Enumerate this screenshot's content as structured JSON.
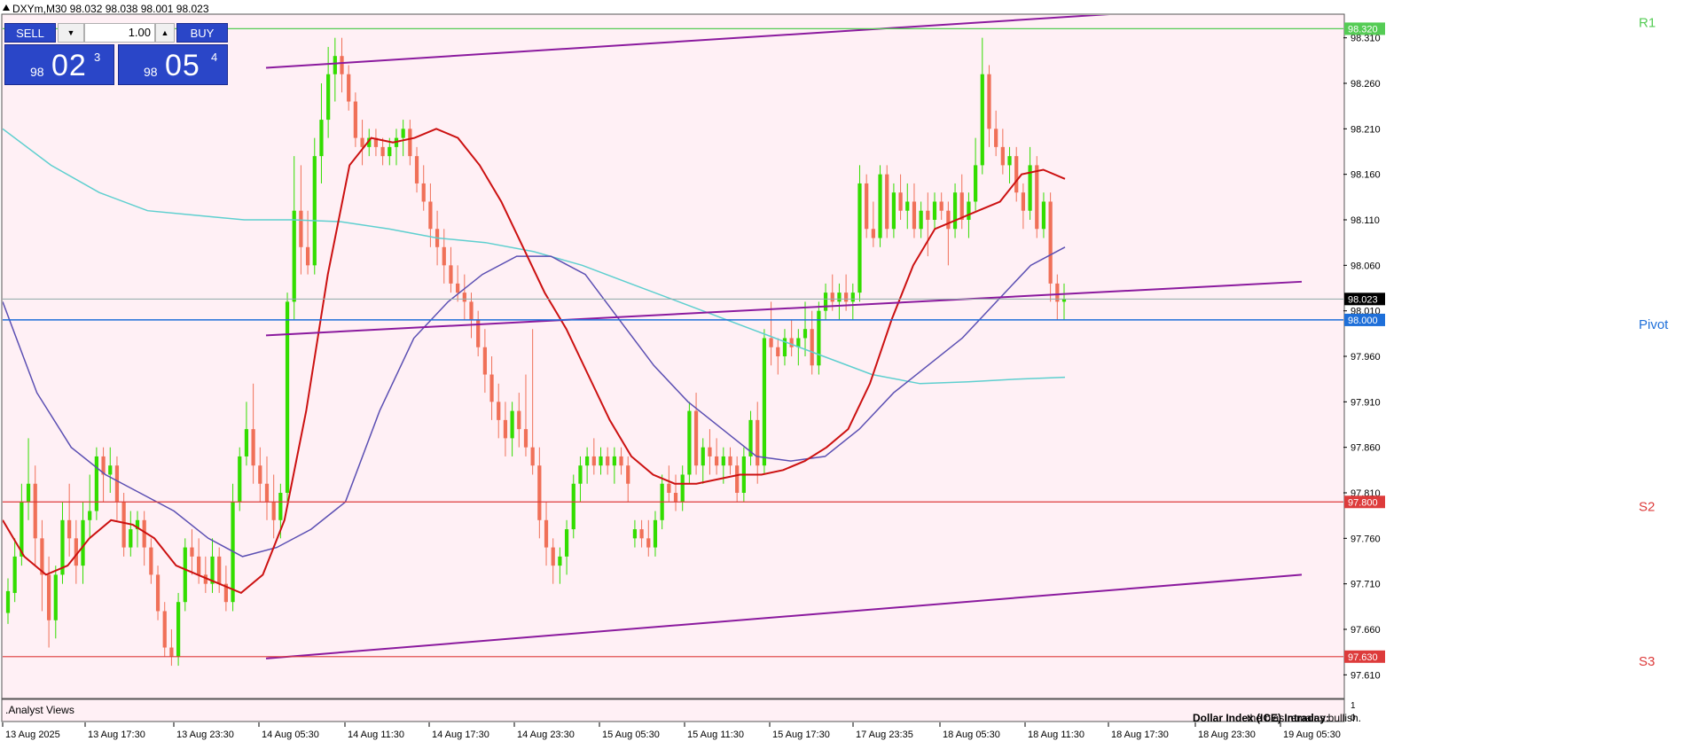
{
  "header": {
    "symbol_info": "DXYm,M30  98.032 98.038 98.001 98.023"
  },
  "trade_panel": {
    "sell_label": "SELL",
    "buy_label": "BUY",
    "lot": "1.00",
    "sell_quote": {
      "small": "98",
      "big": "02",
      "sup": "3"
    },
    "buy_quote": {
      "small": "98",
      "big": "05",
      "sup": "4"
    }
  },
  "indicator_panel": {
    "label": ".Analyst Views",
    "scale_top": "1",
    "scale_bottom": "0",
    "comment_title": "Dollar Index (ICE) Intraday:",
    "comment_text": "the bias remains bullish."
  },
  "colors": {
    "background": "#fff0f5",
    "bull": "#33dd00",
    "bear": "#f07058",
    "ma_red": "#cc1111",
    "ma_blue": "#5b4fb3",
    "ma_cyan": "#5ecfcf",
    "channel": "#8b1a9e",
    "r1": "#55cc55",
    "pivot": "#1e6fd9",
    "support": "#dd3b3b",
    "current": "#2b2b2b"
  },
  "chart_data": {
    "type": "candlestick",
    "timeframe": "M30",
    "ylim": [
      97.585,
      98.335
    ],
    "y_ticks": [
      "98.310",
      "98.260",
      "98.210",
      "98.160",
      "98.110",
      "98.060",
      "98.010",
      "97.960",
      "97.910",
      "97.860",
      "97.810",
      "97.760",
      "97.710",
      "97.660",
      "97.610"
    ],
    "x_labels": [
      "13 Aug 2025",
      "13 Aug 17:30",
      "13 Aug 23:30",
      "14 Aug 05:30",
      "14 Aug 11:30",
      "14 Aug 17:30",
      "14 Aug 23:30",
      "15 Aug 05:30",
      "15 Aug 11:30",
      "15 Aug 17:30",
      "17 Aug 23:35",
      "18 Aug 05:30",
      "18 Aug 11:30",
      "18 Aug 17:30",
      "18 Aug 23:30",
      "19 Aug 05:30"
    ],
    "levels": [
      {
        "name": "R1",
        "value": 98.32,
        "price_label": "98.320",
        "color": "#55cc55"
      },
      {
        "name": "Pivot",
        "value": 98.0,
        "price_label": "98.000",
        "color": "#1e6fd9"
      },
      {
        "name": "S2",
        "value": 97.8,
        "price_label": "97.800",
        "color": "#dd3b3b"
      },
      {
        "name": "S3",
        "value": 97.63,
        "price_label": "97.630",
        "color": "#dd3b3b"
      }
    ],
    "current_price": {
      "value": 98.023,
      "label": "98.023"
    },
    "candles": [
      [
        97.678,
        97.716,
        97.666,
        97.702
      ],
      [
        97.7,
        97.76,
        97.69,
        97.74
      ],
      [
        97.74,
        97.82,
        97.73,
        97.8
      ],
      [
        97.8,
        97.87,
        97.78,
        97.82
      ],
      [
        97.82,
        97.84,
        97.73,
        97.76
      ],
      [
        97.76,
        97.78,
        97.68,
        97.72
      ],
      [
        97.72,
        97.74,
        97.64,
        97.67
      ],
      [
        97.67,
        97.73,
        97.65,
        97.72
      ],
      [
        97.72,
        97.8,
        97.71,
        97.78
      ],
      [
        97.78,
        97.82,
        97.74,
        97.76
      ],
      [
        97.76,
        97.78,
        97.71,
        97.73
      ],
      [
        97.73,
        97.8,
        97.71,
        97.78
      ],
      [
        97.78,
        97.83,
        97.76,
        97.79
      ],
      [
        97.79,
        97.86,
        97.78,
        97.85
      ],
      [
        97.85,
        97.86,
        97.8,
        97.83
      ],
      [
        97.83,
        97.86,
        97.81,
        97.84
      ],
      [
        97.84,
        97.85,
        97.78,
        97.8
      ],
      [
        97.8,
        97.81,
        97.74,
        97.75
      ],
      [
        97.75,
        97.79,
        97.74,
        97.77
      ],
      [
        97.77,
        97.79,
        97.75,
        97.78
      ],
      [
        97.78,
        97.79,
        97.73,
        97.75
      ],
      [
        97.75,
        97.76,
        97.71,
        97.72
      ],
      [
        97.72,
        97.73,
        97.67,
        97.68
      ],
      [
        97.68,
        97.69,
        97.63,
        97.64
      ],
      [
        97.64,
        97.66,
        97.62,
        97.63
      ],
      [
        97.63,
        97.7,
        97.62,
        97.69
      ],
      [
        97.69,
        97.76,
        97.68,
        97.75
      ],
      [
        97.75,
        97.77,
        97.72,
        97.74
      ],
      [
        97.74,
        97.76,
        97.71,
        97.72
      ],
      [
        97.72,
        97.74,
        97.7,
        97.71
      ],
      [
        97.71,
        97.76,
        97.7,
        97.74
      ],
      [
        97.74,
        97.75,
        97.7,
        97.71
      ],
      [
        97.71,
        97.73,
        97.68,
        97.69
      ],
      [
        97.69,
        97.82,
        97.68,
        97.8
      ],
      [
        97.8,
        97.86,
        97.79,
        97.85
      ],
      [
        97.85,
        97.91,
        97.84,
        97.88
      ],
      [
        97.88,
        97.93,
        97.82,
        97.84
      ],
      [
        97.84,
        97.86,
        97.8,
        97.82
      ],
      [
        97.82,
        97.85,
        97.78,
        97.8
      ],
      [
        97.8,
        97.83,
        97.76,
        97.78
      ],
      [
        97.78,
        97.82,
        97.76,
        97.81
      ],
      [
        97.81,
        98.03,
        97.8,
        98.02
      ],
      [
        98.02,
        98.18,
        98.0,
        98.12
      ],
      [
        98.12,
        98.17,
        98.05,
        98.08
      ],
      [
        98.08,
        98.12,
        98.05,
        98.06
      ],
      [
        98.06,
        98.2,
        98.05,
        98.18
      ],
      [
        98.18,
        98.26,
        98.15,
        98.22
      ],
      [
        98.22,
        98.3,
        98.2,
        98.27
      ],
      [
        98.27,
        98.31,
        98.24,
        98.29
      ],
      [
        98.29,
        98.31,
        98.25,
        98.27
      ],
      [
        98.27,
        98.28,
        98.23,
        98.24
      ],
      [
        98.24,
        98.25,
        98.19,
        98.2
      ],
      [
        98.2,
        98.22,
        98.17,
        98.19
      ],
      [
        98.19,
        98.21,
        98.18,
        98.2
      ],
      [
        98.2,
        98.21,
        98.18,
        98.19
      ],
      [
        98.19,
        98.2,
        98.17,
        98.18
      ],
      [
        98.18,
        98.2,
        98.17,
        98.19
      ],
      [
        98.19,
        98.21,
        98.17,
        98.2
      ],
      [
        98.2,
        98.22,
        98.18,
        98.21
      ],
      [
        98.21,
        98.22,
        98.17,
        98.18
      ],
      [
        98.18,
        98.19,
        98.14,
        98.15
      ],
      [
        98.15,
        98.17,
        98.12,
        98.13
      ],
      [
        98.13,
        98.15,
        98.08,
        98.1
      ],
      [
        98.1,
        98.12,
        98.06,
        98.08
      ],
      [
        98.08,
        98.1,
        98.04,
        98.06
      ],
      [
        98.06,
        98.08,
        98.03,
        98.04
      ],
      [
        98.04,
        98.06,
        98.02,
        98.03
      ],
      [
        98.03,
        98.05,
        98.0,
        98.02
      ],
      [
        98.02,
        98.03,
        97.98,
        98.0
      ],
      [
        98.0,
        98.01,
        97.96,
        97.97
      ],
      [
        97.97,
        97.99,
        97.92,
        97.94
      ],
      [
        97.94,
        97.96,
        97.89,
        97.91
      ],
      [
        97.91,
        97.93,
        97.87,
        97.89
      ],
      [
        97.89,
        97.91,
        97.85,
        97.87
      ],
      [
        97.87,
        97.91,
        97.85,
        97.9
      ],
      [
        97.9,
        97.92,
        97.86,
        97.88
      ],
      [
        97.88,
        97.94,
        97.85,
        97.86
      ],
      [
        97.86,
        97.99,
        97.83,
        97.84
      ],
      [
        97.84,
        97.86,
        97.76,
        97.78
      ],
      [
        97.78,
        97.8,
        97.73,
        97.75
      ],
      [
        97.75,
        97.76,
        97.71,
        97.73
      ],
      [
        97.73,
        97.75,
        97.71,
        97.74
      ],
      [
        97.74,
        97.78,
        97.72,
        97.77
      ],
      [
        97.77,
        97.83,
        97.76,
        97.82
      ],
      [
        97.82,
        97.85,
        97.8,
        97.84
      ],
      [
        97.84,
        97.86,
        97.82,
        97.85
      ],
      [
        97.85,
        97.87,
        97.83,
        97.84
      ],
      [
        97.84,
        97.86,
        97.83,
        97.85
      ],
      [
        97.85,
        97.86,
        97.83,
        97.84
      ],
      [
        97.84,
        97.86,
        97.82,
        97.85
      ],
      [
        97.85,
        97.86,
        97.83,
        97.84
      ],
      [
        97.84,
        97.85,
        97.8,
        97.82
      ],
      [
        97.76,
        97.78,
        97.75,
        97.77
      ],
      [
        97.77,
        97.78,
        97.75,
        97.76
      ],
      [
        97.76,
        97.78,
        97.74,
        97.75
      ],
      [
        97.75,
        97.79,
        97.74,
        97.78
      ],
      [
        97.78,
        97.83,
        97.77,
        97.82
      ],
      [
        97.82,
        97.84,
        97.8,
        97.81
      ],
      [
        97.81,
        97.83,
        97.79,
        97.8
      ],
      [
        97.8,
        97.84,
        97.79,
        97.83
      ],
      [
        97.83,
        97.91,
        97.82,
        97.9
      ],
      [
        97.9,
        97.92,
        97.83,
        97.84
      ],
      [
        97.84,
        97.87,
        97.82,
        97.86
      ],
      [
        97.86,
        97.88,
        97.83,
        97.85
      ],
      [
        97.85,
        97.87,
        97.83,
        97.84
      ],
      [
        97.84,
        97.86,
        97.82,
        97.85
      ],
      [
        97.85,
        97.86,
        97.83,
        97.84
      ],
      [
        97.84,
        97.85,
        97.8,
        97.81
      ],
      [
        97.81,
        97.86,
        97.8,
        97.85
      ],
      [
        97.85,
        97.9,
        97.84,
        97.89
      ],
      [
        97.89,
        97.91,
        97.82,
        97.84
      ],
      [
        97.84,
        97.99,
        97.83,
        97.98
      ],
      [
        97.98,
        98.02,
        97.95,
        97.97
      ],
      [
        97.97,
        97.98,
        97.94,
        97.96
      ],
      [
        97.96,
        97.99,
        97.95,
        97.98
      ],
      [
        97.98,
        98.0,
        97.96,
        97.97
      ],
      [
        97.97,
        97.99,
        97.95,
        97.98
      ],
      [
        97.98,
        98.02,
        97.96,
        97.99
      ],
      [
        97.99,
        98.01,
        97.94,
        97.95
      ],
      [
        97.95,
        98.02,
        97.94,
        98.01
      ],
      [
        98.01,
        98.04,
        98.0,
        98.03
      ],
      [
        98.03,
        98.05,
        98.01,
        98.02
      ],
      [
        98.02,
        98.04,
        98.0,
        98.03
      ],
      [
        98.03,
        98.05,
        98.01,
        98.02
      ],
      [
        98.02,
        98.04,
        98.0,
        98.03
      ],
      [
        98.03,
        98.17,
        98.02,
        98.15
      ],
      [
        98.15,
        98.16,
        98.09,
        98.1
      ],
      [
        98.1,
        98.13,
        98.08,
        98.09
      ],
      [
        98.09,
        98.17,
        98.08,
        98.16
      ],
      [
        98.16,
        98.17,
        98.09,
        98.1
      ],
      [
        98.1,
        98.15,
        98.09,
        98.14
      ],
      [
        98.14,
        98.16,
        98.11,
        98.12
      ],
      [
        98.12,
        98.15,
        98.1,
        98.13
      ],
      [
        98.13,
        98.15,
        98.09,
        98.1
      ],
      [
        98.1,
        98.13,
        98.09,
        98.12
      ],
      [
        98.12,
        98.14,
        98.07,
        98.11
      ],
      [
        98.11,
        98.14,
        98.1,
        98.13
      ],
      [
        98.13,
        98.14,
        98.11,
        98.12
      ],
      [
        98.12,
        98.13,
        98.06,
        98.1
      ],
      [
        98.1,
        98.15,
        98.09,
        98.14
      ],
      [
        98.14,
        98.16,
        98.1,
        98.11
      ],
      [
        98.11,
        98.14,
        98.09,
        98.13
      ],
      [
        98.13,
        98.2,
        98.12,
        98.17
      ],
      [
        98.17,
        98.31,
        98.16,
        98.27
      ],
      [
        98.27,
        98.28,
        98.19,
        98.21
      ],
      [
        98.21,
        98.23,
        98.18,
        98.19
      ],
      [
        98.19,
        98.21,
        98.16,
        98.17
      ],
      [
        98.17,
        98.19,
        98.15,
        98.18
      ],
      [
        98.18,
        98.19,
        98.13,
        98.14
      ],
      [
        98.14,
        98.15,
        98.1,
        98.12
      ],
      [
        98.12,
        98.19,
        98.11,
        98.17
      ],
      [
        98.17,
        98.18,
        98.09,
        98.1
      ],
      [
        98.1,
        98.14,
        98.09,
        98.13
      ],
      [
        98.13,
        98.14,
        98.02,
        98.04
      ],
      [
        98.04,
        98.05,
        98.0,
        98.02
      ],
      [
        98.02,
        98.04,
        98.0,
        98.023
      ]
    ],
    "ma_red": [
      97.78,
      97.74,
      97.72,
      97.73,
      97.76,
      97.78,
      97.775,
      97.76,
      97.73,
      97.72,
      97.71,
      97.7,
      97.72,
      97.78,
      97.9,
      98.05,
      98.17,
      98.2,
      98.195,
      98.2,
      98.21,
      98.2,
      98.17,
      98.13,
      98.08,
      98.03,
      97.99,
      97.94,
      97.89,
      97.85,
      97.83,
      97.82,
      97.82,
      97.825,
      97.83,
      97.83,
      97.835,
      97.845,
      97.86,
      97.88,
      97.93,
      98.0,
      98.06,
      98.1,
      98.11,
      98.12,
      98.13,
      98.16,
      98.165,
      98.155
    ],
    "ma_blue": [
      98.02,
      97.92,
      97.86,
      97.83,
      97.81,
      97.79,
      97.76,
      97.74,
      97.75,
      97.77,
      97.8,
      97.9,
      97.98,
      98.02,
      98.05,
      98.07,
      98.07,
      98.05,
      98.0,
      97.95,
      97.91,
      97.88,
      97.85,
      97.845,
      97.85,
      97.88,
      97.92,
      97.95,
      97.98,
      98.02,
      98.06,
      98.08
    ],
    "ma_cyan": [
      98.21,
      98.17,
      98.14,
      98.12,
      98.115,
      98.11,
      98.11,
      98.108,
      98.1,
      98.09,
      98.085,
      98.075,
      98.06,
      98.04,
      98.02,
      98.0,
      97.98,
      97.96,
      97.94,
      97.93,
      97.932,
      97.935,
      97.937
    ],
    "channel": {
      "top": [
        98.277,
        98.337
      ],
      "middle": [
        97.983,
        98.042
      ],
      "bottom": [
        97.628,
        97.72
      ]
    }
  }
}
